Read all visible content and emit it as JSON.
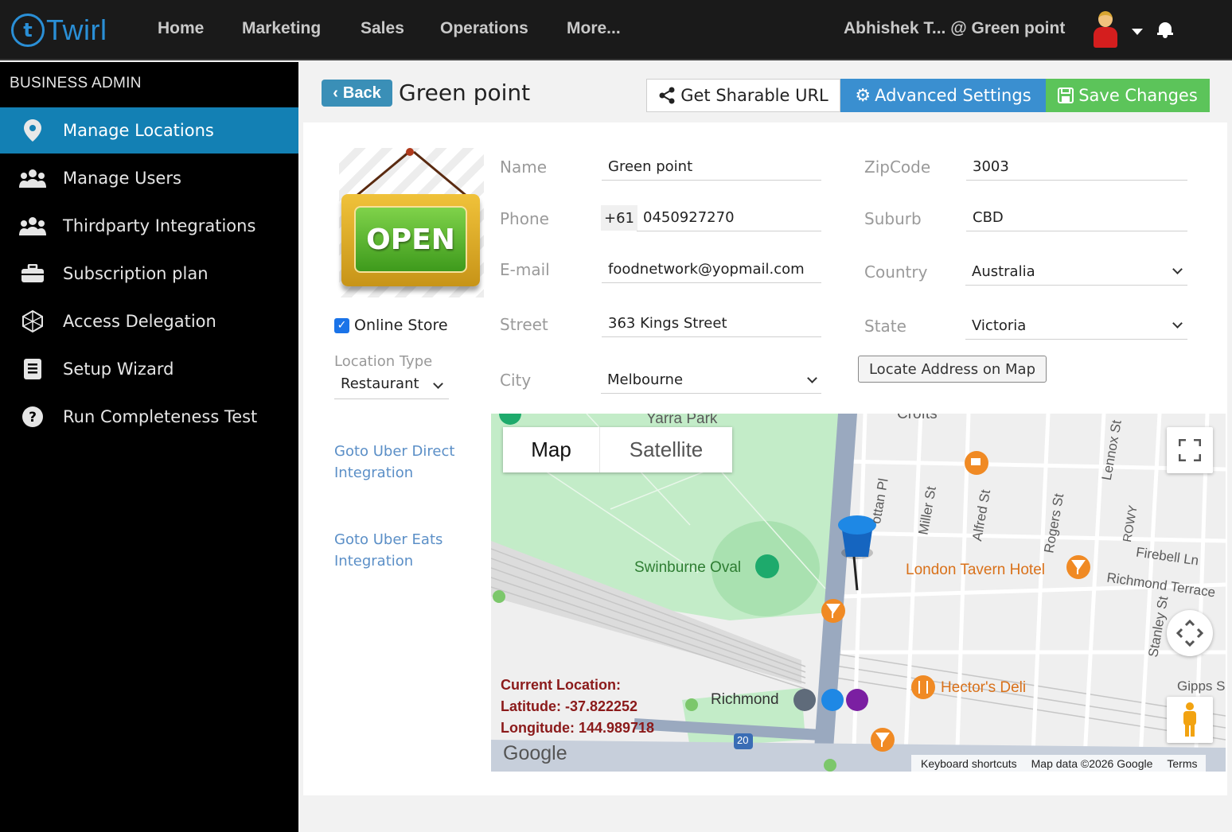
{
  "app": {
    "logo_text": "Twirl",
    "nav": [
      "Home",
      "Marketing",
      "Sales",
      "Operations",
      "More..."
    ],
    "user_label": "Abhishek T...  @ Green point"
  },
  "sidebar": {
    "title": "BUSINESS ADMIN",
    "items": [
      {
        "label": "Manage Locations",
        "icon": "location-pin-icon"
      },
      {
        "label": "Manage Users",
        "icon": "users-icon"
      },
      {
        "label": "Thirdparty Integrations",
        "icon": "users-icon"
      },
      {
        "label": "Subscription plan",
        "icon": "briefcase-icon"
      },
      {
        "label": "Access Delegation",
        "icon": "network-icon"
      },
      {
        "label": "Setup Wizard",
        "icon": "book-icon"
      },
      {
        "label": "Run Completeness Test",
        "icon": "question-icon"
      }
    ]
  },
  "header": {
    "back_label": "Back",
    "title": "Green point",
    "share_label": "Get Sharable URL",
    "advanced_label": "Advanced Settings",
    "save_label": "Save Changes"
  },
  "left": {
    "sign_text": "OPEN",
    "online_store_label": "Online Store",
    "online_store_checked": true,
    "location_type_label": "Location Type",
    "location_type_value": "Restaurant",
    "uber_direct_link": "Goto Uber Direct Integration",
    "uber_eats_link": "Goto Uber Eats Integration"
  },
  "form": {
    "name_label": "Name",
    "name_value": "Green point",
    "phone_label": "Phone",
    "phone_prefix": "+61",
    "phone_value": "0450927270",
    "email_label": "E-mail",
    "email_value": "foodnetwork@yopmail.com",
    "street_label": "Street",
    "street_value": "363 Kings Street",
    "city_label": "City",
    "city_value": "Melbourne",
    "zipcode_label": "ZipCode",
    "zipcode_value": "3003",
    "suburb_label": "Suburb",
    "suburb_value": "CBD",
    "country_label": "Country",
    "country_value": "Australia",
    "state_label": "State",
    "state_value": "Victoria",
    "locate_label": "Locate Address on Map"
  },
  "map": {
    "tab_map": "Map",
    "tab_satellite": "Satellite",
    "labels": {
      "yarra_park": "Yarra Park",
      "swinburne": "Swinburne Oval",
      "london_tavern": "London Tavern Hotel",
      "richmond": "Richmond",
      "hectors": "Hector's Deli",
      "richmond_terrace": "Richmond Terrace",
      "firebell": "Firebell Ln",
      "gipps": "Gipps S",
      "miller": "Miller St",
      "alfred": "Alfred St",
      "rogers": "Rogers St",
      "lennox": "Lennox St",
      "rowy": "ROWY",
      "stanley": "Stanley St",
      "ottan": "ottan Pl",
      "crofts": "Crofts",
      "road_20": "20"
    },
    "current_location": {
      "title": "Current Location:",
      "latitude": "Latitude: -37.822252",
      "longitude": "Longitude: 144.989718"
    },
    "google": "Google",
    "footer": {
      "shortcuts": "Keyboard shortcuts",
      "data": "Map data ©2026 Google",
      "terms": "Terms"
    },
    "colors": {
      "park": "#c3ecc8",
      "road": "#9aa9bf",
      "poi_orange": "#f08a24"
    }
  }
}
